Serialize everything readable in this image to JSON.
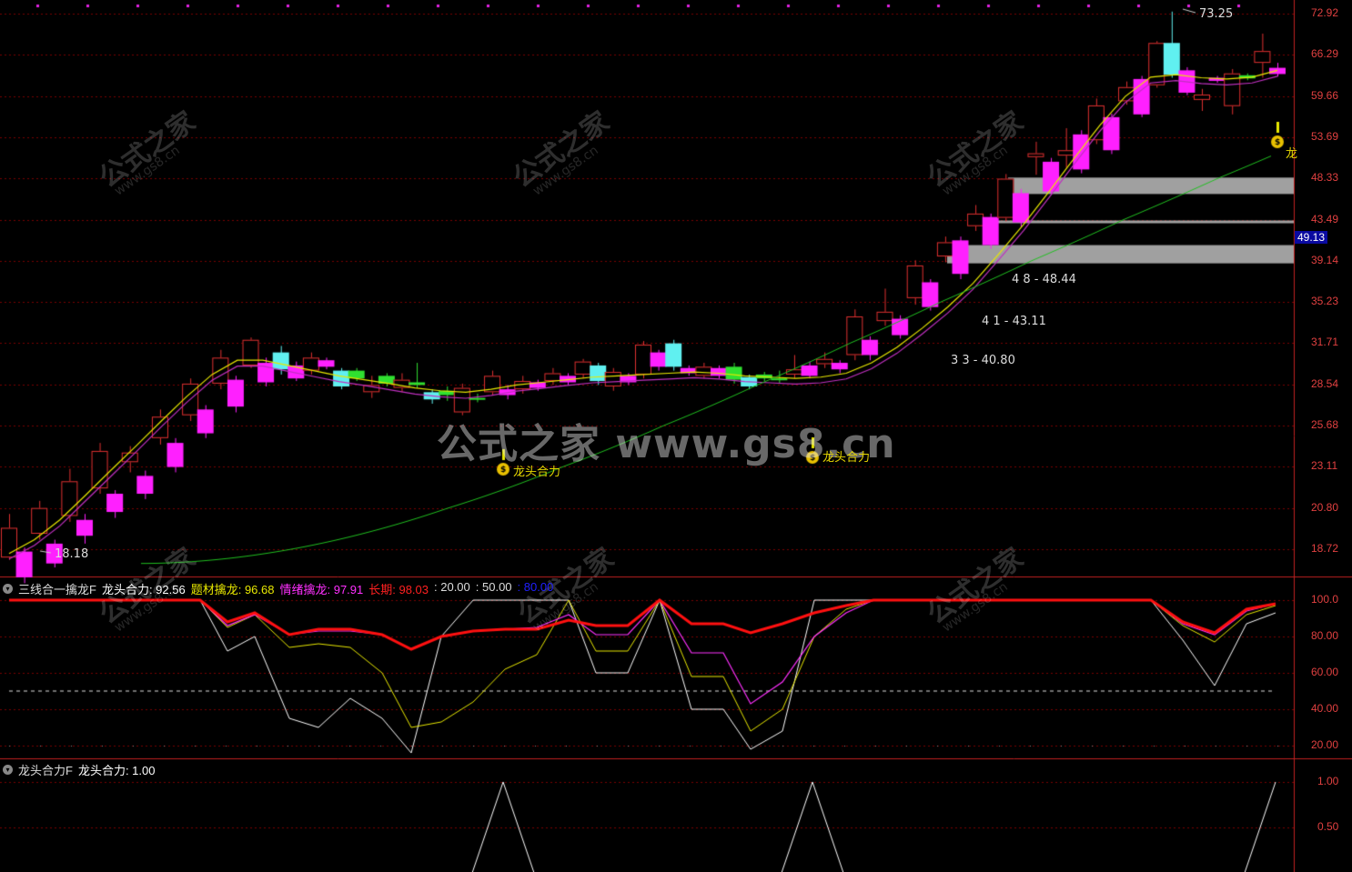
{
  "colors": {
    "bg": "#000000",
    "grid": "#7a0000",
    "axis": "#e04040",
    "up": "#e03030",
    "down_magenta": "#ff20ff",
    "cyan": "#60f0f0",
    "green_candle": "#30e030",
    "ma_yellow": "#e8e800",
    "ma_purple": "#c030c0",
    "ma_green": "#20c020",
    "band": "#a0a0a0",
    "red_line": "#ff1010"
  },
  "main_axis": {
    "labels": [
      "72.92",
      "66.29",
      "59.66",
      "53.69",
      "48.33",
      "43.49",
      "39.14",
      "35.23",
      "31.71",
      "28.54",
      "25.68",
      "23.11",
      "20.80",
      "18.72"
    ]
  },
  "price_tag": "49.13",
  "annotations": {
    "high": "73.25",
    "low": "18.18",
    "zone1": "4    8 - 48.44",
    "zone2": "4    1 - 43.11",
    "zone3": "3    3 - 40.80",
    "signal1": "龙头合力",
    "signal2": "龙头合力",
    "signal3": "龙"
  },
  "panel2": {
    "title": "三线合一擒龙F",
    "items": [
      {
        "label": "龙头合力: 92.56",
        "color": "#ffffff"
      },
      {
        "label": "题材擒龙: 96.68",
        "color": "#e8e800"
      },
      {
        "label": "情绪擒龙: 97.91",
        "color": "#ff30ff"
      },
      {
        "label": "长期: 98.03",
        "color": "#ff2020"
      },
      {
        "label": ": 20.00",
        "color": "#dddddd"
      },
      {
        "label": ": 50.00",
        "color": "#dddddd"
      },
      {
        "label": ": 80.00",
        "color": "#2020ff"
      }
    ],
    "axis": [
      "100.0",
      "80.00",
      "60.00",
      "40.00",
      "20.00"
    ]
  },
  "panel3": {
    "title": "龙头合力F",
    "items": [
      {
        "label": "龙头合力: 1.00",
        "color": "#ffffff"
      }
    ],
    "axis": [
      "1.00",
      "0.50"
    ]
  },
  "watermark": {
    "brand": "公式之家",
    "url": "www.gs8.cn",
    "center": "公式之家 www.gs8.cn"
  },
  "chart_data": {
    "type": "candlestick",
    "candles": [
      {
        "o": 18.3,
        "c": 19.8,
        "h": 20.5,
        "l": 18.18,
        "k": "up"
      },
      {
        "o": 18.6,
        "c": 17.3,
        "h": 18.8,
        "l": 17.0,
        "k": "mag"
      },
      {
        "o": 19.5,
        "c": 20.8,
        "h": 21.2,
        "l": 19.2,
        "k": "up"
      },
      {
        "o": 19.0,
        "c": 18.0,
        "h": 19.2,
        "l": 17.8,
        "k": "mag"
      },
      {
        "o": 20.4,
        "c": 22.3,
        "h": 23.0,
        "l": 20.1,
        "k": "up"
      },
      {
        "o": 20.2,
        "c": 19.4,
        "h": 20.5,
        "l": 19.0,
        "k": "mag"
      },
      {
        "o": 21.9,
        "c": 24.1,
        "h": 24.6,
        "l": 21.6,
        "k": "up"
      },
      {
        "o": 21.6,
        "c": 20.6,
        "h": 21.8,
        "l": 20.3,
        "k": "mag"
      },
      {
        "o": 23.4,
        "c": 24.0,
        "h": 24.4,
        "l": 22.8,
        "k": "up"
      },
      {
        "o": 22.6,
        "c": 21.6,
        "h": 22.9,
        "l": 21.3,
        "k": "mag"
      },
      {
        "o": 24.9,
        "c": 26.3,
        "h": 26.8,
        "l": 24.5,
        "k": "up"
      },
      {
        "o": 24.6,
        "c": 23.1,
        "h": 24.9,
        "l": 22.8,
        "k": "mag"
      },
      {
        "o": 26.4,
        "c": 28.6,
        "h": 29.0,
        "l": 26.0,
        "k": "up"
      },
      {
        "o": 26.8,
        "c": 25.2,
        "h": 27.1,
        "l": 24.9,
        "k": "mag"
      },
      {
        "o": 28.6,
        "c": 30.6,
        "h": 31.2,
        "l": 28.2,
        "k": "up"
      },
      {
        "o": 28.9,
        "c": 27.0,
        "h": 29.2,
        "l": 26.6,
        "k": "mag"
      },
      {
        "o": 30.0,
        "c": 32.0,
        "h": 32.2,
        "l": 29.8,
        "k": "up"
      },
      {
        "o": 30.2,
        "c": 28.7,
        "h": 30.6,
        "l": 28.4,
        "k": "mag"
      },
      {
        "o": 31.0,
        "c": 29.7,
        "h": 31.5,
        "l": 29.3,
        "k": "cyan"
      },
      {
        "o": 30.0,
        "c": 29.0,
        "h": 30.3,
        "l": 28.8,
        "k": "mag"
      },
      {
        "o": 29.6,
        "c": 30.6,
        "h": 31.0,
        "l": 29.3,
        "k": "up"
      },
      {
        "o": 30.4,
        "c": 29.9,
        "h": 30.6,
        "l": 29.7,
        "k": "mag"
      },
      {
        "o": 29.6,
        "c": 28.4,
        "h": 29.8,
        "l": 28.2,
        "k": "cyan"
      },
      {
        "o": 29.6,
        "c": 29.0,
        "h": 29.8,
        "l": 28.8,
        "k": "green"
      },
      {
        "o": 28.0,
        "c": 28.5,
        "h": 29.2,
        "l": 27.6,
        "k": "up"
      },
      {
        "o": 29.2,
        "c": 28.6,
        "h": 29.4,
        "l": 28.4,
        "k": "green"
      },
      {
        "o": 28.3,
        "c": 28.9,
        "h": 29.4,
        "l": 28.0,
        "k": "up"
      },
      {
        "o": 28.7,
        "c": 28.5,
        "h": 30.2,
        "l": 28.3,
        "k": "green"
      },
      {
        "o": 27.5,
        "c": 28.0,
        "h": 28.2,
        "l": 27.2,
        "k": "cyan"
      },
      {
        "o": 28.1,
        "c": 27.8,
        "h": 28.4,
        "l": 27.4,
        "k": "green"
      },
      {
        "o": 26.6,
        "c": 28.3,
        "h": 28.6,
        "l": 26.4,
        "k": "up"
      },
      {
        "o": 27.6,
        "c": 27.6,
        "h": 27.9,
        "l": 27.3,
        "k": "green"
      },
      {
        "o": 28.0,
        "c": 29.2,
        "h": 29.6,
        "l": 27.8,
        "k": "up"
      },
      {
        "o": 28.2,
        "c": 27.8,
        "h": 28.5,
        "l": 27.5,
        "k": "mag"
      },
      {
        "o": 28.2,
        "c": 28.8,
        "h": 29.2,
        "l": 27.9,
        "k": "up"
      },
      {
        "o": 28.7,
        "c": 28.3,
        "h": 28.9,
        "l": 28.1,
        "k": "mag"
      },
      {
        "o": 28.8,
        "c": 29.4,
        "h": 29.8,
        "l": 28.5,
        "k": "up"
      },
      {
        "o": 29.2,
        "c": 28.7,
        "h": 29.4,
        "l": 28.5,
        "k": "mag"
      },
      {
        "o": 29.3,
        "c": 30.3,
        "h": 30.5,
        "l": 29.0,
        "k": "up"
      },
      {
        "o": 30.0,
        "c": 28.8,
        "h": 30.2,
        "l": 28.5,
        "k": "cyan"
      },
      {
        "o": 28.4,
        "c": 29.5,
        "h": 29.8,
        "l": 28.1,
        "k": "up"
      },
      {
        "o": 29.2,
        "c": 28.7,
        "h": 29.4,
        "l": 28.5,
        "k": "mag"
      },
      {
        "o": 29.3,
        "c": 31.6,
        "h": 31.9,
        "l": 29.0,
        "k": "up"
      },
      {
        "o": 31.0,
        "c": 29.9,
        "h": 31.2,
        "l": 29.6,
        "k": "mag"
      },
      {
        "o": 31.7,
        "c": 29.9,
        "h": 32.0,
        "l": 29.6,
        "k": "cyan"
      },
      {
        "o": 29.8,
        "c": 29.4,
        "h": 30.0,
        "l": 29.2,
        "k": "mag"
      },
      {
        "o": 29.2,
        "c": 29.9,
        "h": 30.2,
        "l": 29.0,
        "k": "up"
      },
      {
        "o": 29.8,
        "c": 29.2,
        "h": 30.0,
        "l": 29.0,
        "k": "mag"
      },
      {
        "o": 29.9,
        "c": 28.9,
        "h": 30.2,
        "l": 28.6,
        "k": "green"
      },
      {
        "o": 29.1,
        "c": 28.4,
        "h": 29.3,
        "l": 28.2,
        "k": "cyan"
      },
      {
        "o": 29.3,
        "c": 29.0,
        "h": 29.5,
        "l": 28.8,
        "k": "green"
      },
      {
        "o": 28.9,
        "c": 29.0,
        "h": 29.6,
        "l": 28.6,
        "k": "green"
      },
      {
        "o": 29.3,
        "c": 29.7,
        "h": 30.8,
        "l": 29.0,
        "k": "up"
      },
      {
        "o": 30.0,
        "c": 29.2,
        "h": 30.3,
        "l": 29.0,
        "k": "mag"
      },
      {
        "o": 30.1,
        "c": 30.5,
        "h": 31.0,
        "l": 29.8,
        "k": "up"
      },
      {
        "o": 30.2,
        "c": 29.7,
        "h": 30.4,
        "l": 29.4,
        "k": "mag"
      },
      {
        "o": 30.8,
        "c": 34.0,
        "h": 34.6,
        "l": 30.4,
        "k": "up"
      },
      {
        "o": 32.0,
        "c": 30.8,
        "h": 32.3,
        "l": 30.4,
        "k": "mag"
      },
      {
        "o": 33.6,
        "c": 34.4,
        "h": 36.5,
        "l": 33.2,
        "k": "up"
      },
      {
        "o": 33.8,
        "c": 32.4,
        "h": 34.1,
        "l": 32.1,
        "k": "mag"
      },
      {
        "o": 35.6,
        "c": 38.7,
        "h": 39.2,
        "l": 35.0,
        "k": "up"
      },
      {
        "o": 37.1,
        "c": 34.8,
        "h": 37.4,
        "l": 34.5,
        "k": "mag"
      },
      {
        "o": 39.6,
        "c": 41.1,
        "h": 41.7,
        "l": 39.0,
        "k": "up"
      },
      {
        "o": 41.3,
        "c": 37.9,
        "h": 41.7,
        "l": 37.4,
        "k": "mag"
      },
      {
        "o": 42.8,
        "c": 44.2,
        "h": 45.2,
        "l": 42.3,
        "k": "up"
      },
      {
        "o": 43.8,
        "c": 40.8,
        "h": 44.2,
        "l": 40.4,
        "k": "mag"
      },
      {
        "o": 43.7,
        "c": 48.3,
        "h": 48.9,
        "l": 43.3,
        "k": "up"
      },
      {
        "o": 46.6,
        "c": 43.2,
        "h": 47.1,
        "l": 42.7,
        "k": "mag"
      },
      {
        "o": 51.1,
        "c": 51.6,
        "h": 53.1,
        "l": 48.8,
        "k": "up"
      },
      {
        "o": 50.5,
        "c": 46.8,
        "h": 51.0,
        "l": 46.4,
        "k": "mag"
      },
      {
        "o": 51.3,
        "c": 52.0,
        "h": 55.0,
        "l": 49.7,
        "k": "up"
      },
      {
        "o": 54.1,
        "c": 49.5,
        "h": 54.7,
        "l": 49.0,
        "k": "mag"
      },
      {
        "o": 53.3,
        "c": 58.3,
        "h": 59.3,
        "l": 52.8,
        "k": "up"
      },
      {
        "o": 56.6,
        "c": 52.0,
        "h": 57.1,
        "l": 51.5,
        "k": "mag"
      },
      {
        "o": 58.9,
        "c": 61.1,
        "h": 62.0,
        "l": 58.4,
        "k": "up"
      },
      {
        "o": 62.4,
        "c": 57.0,
        "h": 62.9,
        "l": 56.6,
        "k": "mag"
      },
      {
        "o": 61.4,
        "c": 68.2,
        "h": 68.5,
        "l": 61.0,
        "k": "up"
      },
      {
        "o": 68.2,
        "c": 63.1,
        "h": 73.25,
        "l": 62.6,
        "k": "cyan"
      },
      {
        "o": 63.8,
        "c": 60.2,
        "h": 64.3,
        "l": 59.8,
        "k": "mag"
      },
      {
        "o": 59.9,
        "c": 59.1,
        "h": 60.8,
        "l": 57.5,
        "k": "up"
      },
      {
        "o": 62.6,
        "c": 62.1,
        "h": 62.9,
        "l": 61.8,
        "k": "mag"
      },
      {
        "o": 58.2,
        "c": 63.3,
        "h": 64.0,
        "l": 57.0,
        "k": "up"
      },
      {
        "o": 63.0,
        "c": 62.5,
        "h": 63.3,
        "l": 62.2,
        "k": "green"
      },
      {
        "o": 65.0,
        "c": 66.9,
        "h": 69.7,
        "l": 62.6,
        "k": "up"
      },
      {
        "o": 63.2,
        "c": 64.2,
        "h": 65.0,
        "l": 62.8,
        "k": "mag"
      }
    ],
    "ma_yellow": [
      18.5,
      19.2,
      20.2,
      21.5,
      22.9,
      24.4,
      26.0,
      27.7,
      29.3,
      30.4,
      30.4,
      30.0,
      29.6,
      29.2,
      28.9,
      28.6,
      28.3,
      28.1,
      28.0,
      28.2,
      28.5,
      28.7,
      28.9,
      29.1,
      29.2,
      29.3,
      29.4,
      29.5,
      29.4,
      29.2,
      29.1,
      29.0,
      29.1,
      29.4,
      30.2,
      31.4,
      33.0,
      34.8,
      37.0,
      39.8,
      43.0,
      46.8,
      51.0,
      55.4,
      59.6,
      62.7,
      63.1,
      62.6,
      62.4,
      62.7,
      63.8
    ],
    "ma_green_start": 18.0,
    "ma_green_end": 51.5,
    "bands": [
      {
        "from": 46.5,
        "to": 48.44
      },
      {
        "from": 43.11,
        "to": 43.4
      },
      {
        "from": 38.9,
        "to": 40.8
      }
    ],
    "osc": {
      "x": [
        0,
        1,
        2,
        3,
        4,
        5,
        6,
        7,
        8,
        9,
        10,
        11,
        12,
        13,
        14,
        15,
        16,
        17,
        18,
        19,
        20,
        21,
        22,
        23,
        24,
        25
      ],
      "white": [
        100,
        100,
        100,
        100,
        100,
        100,
        100,
        72,
        80,
        35,
        30,
        45,
        35,
        16,
        78,
        100,
        100,
        100,
        60,
        60,
        100,
        40,
        40,
        18,
        28,
        100
      ],
      "yellow": [
        100,
        100,
        100,
        100,
        100,
        100,
        100,
        85,
        92,
        74,
        76,
        74,
        60,
        30,
        33,
        44,
        62,
        70,
        72,
        72,
        100,
        58,
        58,
        28,
        40,
        80
      ],
      "magenta": [
        100,
        100,
        100,
        100,
        100,
        100,
        100,
        86,
        92,
        80,
        83,
        83,
        81,
        73,
        79,
        83,
        84,
        90,
        82,
        82,
        100,
        71,
        71,
        43,
        55,
        88
      ],
      "red": [
        100,
        100,
        100,
        100,
        100,
        100,
        100,
        88,
        93,
        81,
        84,
        84,
        81,
        73,
        80,
        83,
        84,
        88,
        86,
        86,
        100,
        87,
        87,
        82,
        87,
        93
      ]
    },
    "signal_pulses": [
      553,
      893,
      1400
    ]
  }
}
